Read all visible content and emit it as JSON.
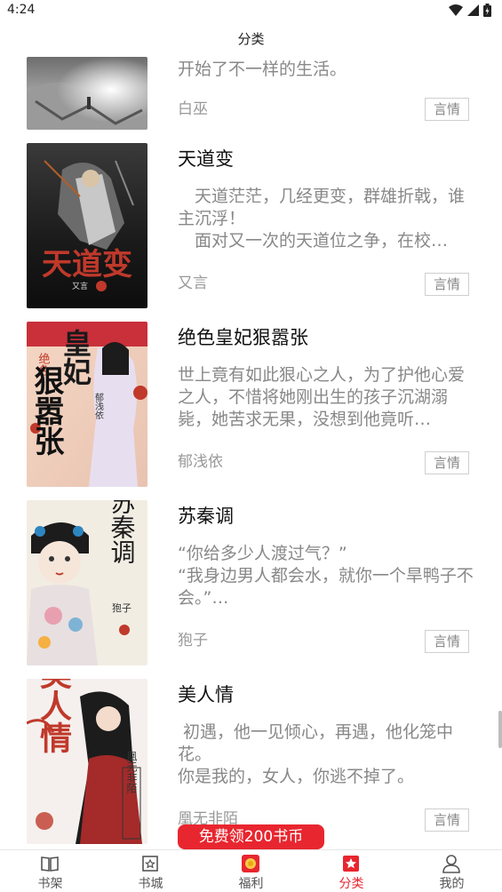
{
  "status_bar": {
    "time": "4:24"
  },
  "header": {
    "title": "分类"
  },
  "books": [
    {
      "title": "",
      "description": "开始了不一样的生活。",
      "author": "白巫",
      "tag": "言情"
    },
    {
      "title": "天道变",
      "description": "　天道茫茫，几经更变，群雄折戟，谁主沉浮！\n　面对又一次的天道位之争，在校…",
      "author": "又言",
      "tag": "言情"
    },
    {
      "title": "绝色皇妃狠嚣张",
      "description": "世上竟有如此狠心之人，为了护他心爱之人，不惜将她刚出生的孩子沉湖溺毙，她苦求无果，没想到他竟听…",
      "author": "郁浅依",
      "tag": "言情"
    },
    {
      "title": "苏秦调",
      "description": "“你给多少人渡过气？”\n“我身边男人都会水，就你一个旱鸭子不会。”…",
      "author": "狍子",
      "tag": "言情"
    },
    {
      "title": "美人情",
      "description": " 初遇，他一见倾心，再遇，他化笼中花。\n你是我的，女人，你逃不掉了。",
      "author": "凰无非陌",
      "tag": "言情"
    }
  ],
  "covers": {
    "tiandao": {
      "text": "天道变",
      "author": "又言"
    },
    "huangfei": {
      "text_top": "皇妃",
      "text_left": "绝色",
      "text_main": "狠嚣张",
      "author": "郁浅依"
    },
    "suqin": {
      "text": "苏秦调",
      "author": "狍子"
    },
    "meiren": {
      "text": "美人情",
      "author": "凰无非陌"
    }
  },
  "promo": {
    "label": "免费领200书币"
  },
  "tabbar": [
    {
      "label": "书架",
      "icon": "book-open-icon",
      "active": false
    },
    {
      "label": "书城",
      "icon": "store-icon",
      "active": false
    },
    {
      "label": "福利",
      "icon": "gift-icon",
      "active": false
    },
    {
      "label": "分类",
      "icon": "category-icon",
      "active": true
    },
    {
      "label": "我的",
      "icon": "user-icon",
      "active": false
    }
  ],
  "colors": {
    "accent": "#e8262f",
    "text_primary": "#111111",
    "text_secondary": "#888888"
  }
}
